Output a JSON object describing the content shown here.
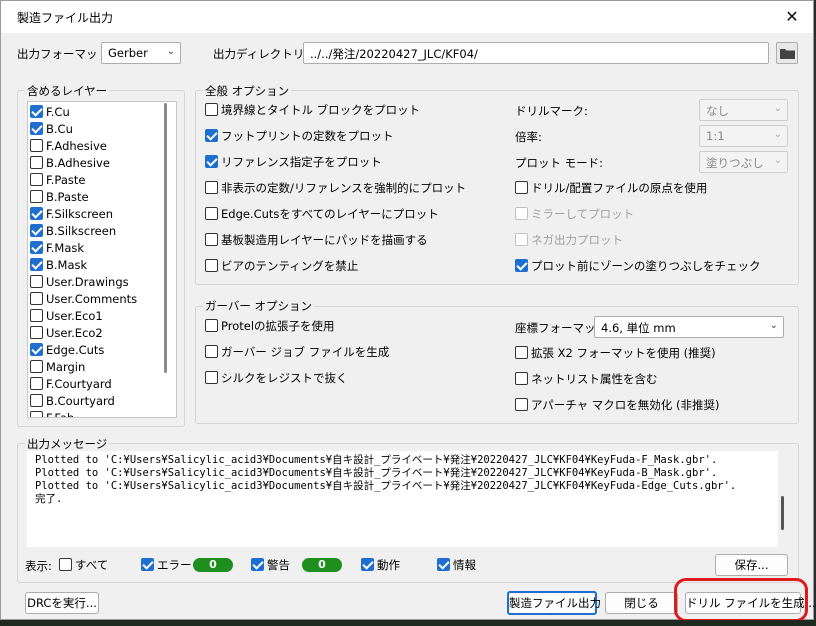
{
  "window": {
    "title": "製造ファイル出力",
    "close_glyph": "✕"
  },
  "top": {
    "format_label": "出力フォーマット:",
    "format_value": "Gerber",
    "dir_label": "出力ディレクトリー:",
    "dir_value": "../../発注/20220427_JLC/KF04/"
  },
  "layers": {
    "title": "含めるレイヤー",
    "items": [
      {
        "label": "F.Cu",
        "checked": true
      },
      {
        "label": "B.Cu",
        "checked": true
      },
      {
        "label": "F.Adhesive",
        "checked": false
      },
      {
        "label": "B.Adhesive",
        "checked": false
      },
      {
        "label": "F.Paste",
        "checked": false
      },
      {
        "label": "B.Paste",
        "checked": false
      },
      {
        "label": "F.Silkscreen",
        "checked": true
      },
      {
        "label": "B.Silkscreen",
        "checked": true
      },
      {
        "label": "F.Mask",
        "checked": true
      },
      {
        "label": "B.Mask",
        "checked": true
      },
      {
        "label": "User.Drawings",
        "checked": false
      },
      {
        "label": "User.Comments",
        "checked": false
      },
      {
        "label": "User.Eco1",
        "checked": false
      },
      {
        "label": "User.Eco2",
        "checked": false
      },
      {
        "label": "Edge.Cuts",
        "checked": true
      },
      {
        "label": "Margin",
        "checked": false
      },
      {
        "label": "F.Courtyard",
        "checked": false
      },
      {
        "label": "B.Courtyard",
        "checked": false
      },
      {
        "label": "F.Fab",
        "checked": false
      }
    ]
  },
  "general": {
    "title": "全般 オプション",
    "options": [
      {
        "label": "境界線とタイトル ブロックをプロット",
        "checked": false
      },
      {
        "label": "フットプリントの定数をプロット",
        "checked": true
      },
      {
        "label": "リファレンス指定子をプロット",
        "checked": true
      },
      {
        "label": "非表示の定数/リファレンスを強制的にプロット",
        "checked": false
      },
      {
        "label": "Edge.Cutsをすべてのレイヤーにプロット",
        "checked": false
      },
      {
        "label": "基板製造用レイヤーにパッドを描画する",
        "checked": false
      },
      {
        "label": "ビアのテンティングを禁止",
        "checked": false
      }
    ],
    "drill_mark_label": "ドリルマーク:",
    "drill_mark_value": "なし",
    "scale_label": "倍率:",
    "scale_value": "1:1",
    "plot_mode_label": "プロット モード:",
    "plot_mode_value": "塗りつぶし",
    "right_options": [
      {
        "label": "ドリル/配置ファイルの原点を使用",
        "checked": false,
        "disabled": false
      },
      {
        "label": "ミラーしてプロット",
        "checked": false,
        "disabled": true
      },
      {
        "label": "ネガ出力プロット",
        "checked": false,
        "disabled": true
      },
      {
        "label": "プロット前にゾーンの塗りつぶしをチェック",
        "checked": true,
        "disabled": false
      }
    ]
  },
  "gerber": {
    "title": "ガーバー オプション",
    "options": [
      {
        "label": "Protelの拡張子を使用",
        "checked": false
      },
      {
        "label": "ガーバー ジョブ ファイルを生成",
        "checked": false
      },
      {
        "label": "シルクをレジストで抜く",
        "checked": false
      }
    ],
    "coord_label": "座標フォーマット:",
    "coord_value": "4.6, 単位 mm",
    "right_options": [
      {
        "label": "拡張 X2 フォーマットを使用 (推奨)",
        "checked": false
      },
      {
        "label": "ネットリスト属性を含む",
        "checked": false
      },
      {
        "label": "アパーチャ マクロを無効化 (非推奨)",
        "checked": false
      }
    ]
  },
  "messages": {
    "title": "出力メッセージ",
    "lines": [
      "Plotted to 'C:¥Users¥Salicylic_acid3¥Documents¥自キ設計_プライベート¥発注¥20220427_JLC¥KF04¥KeyFuda-F_Mask.gbr'.",
      "Plotted to 'C:¥Users¥Salicylic_acid3¥Documents¥自キ設計_プライベート¥発注¥20220427_JLC¥KF04¥KeyFuda-B_Mask.gbr'.",
      "Plotted to 'C:¥Users¥Salicylic_acid3¥Documents¥自キ設計_プライベート¥発注¥20220427_JLC¥KF04¥KeyFuda-Edge_Cuts.gbr'.",
      "完了."
    ],
    "show_label": "表示:",
    "filter_all": "すべて",
    "filter_error": "エラー",
    "error_count": "0",
    "filter_warning": "警告",
    "warning_count": "0",
    "filter_action": "動作",
    "filter_info": "情報",
    "save_button": "保存..."
  },
  "footer": {
    "drc_button": "DRCを実行...",
    "plot_button": "製造ファイル出力",
    "close_button": "閉じる",
    "drill_button": "ドリル ファイルを生成..."
  },
  "colors": {
    "accent": "#1f6fd0",
    "badge": "#1e8e1e",
    "highlight": "#e01a1a"
  }
}
